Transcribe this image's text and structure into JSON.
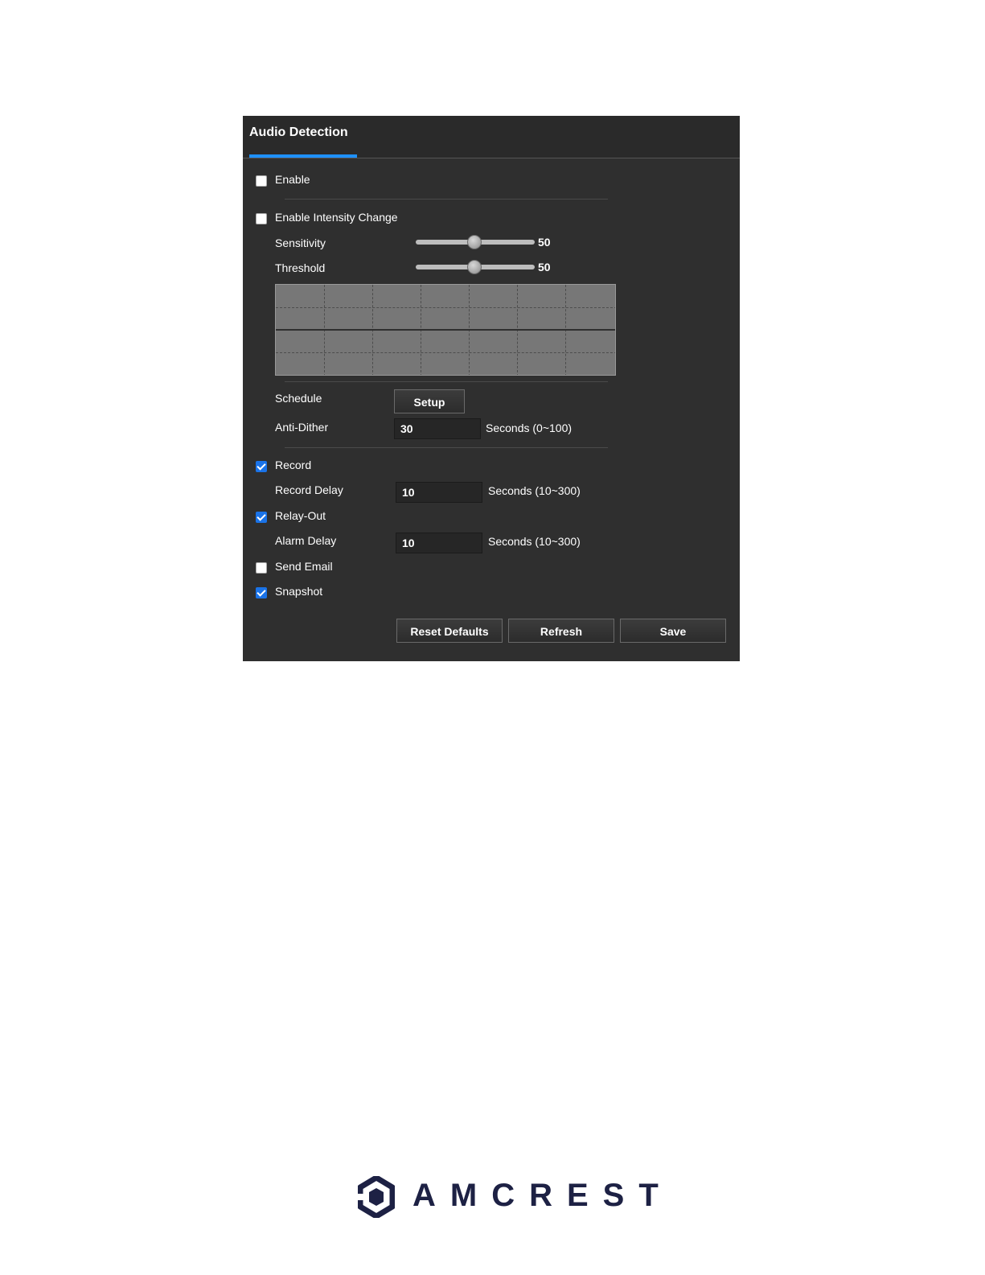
{
  "header": {
    "title": "Audio Detection"
  },
  "form": {
    "enable": {
      "label": "Enable",
      "checked": false
    },
    "intensity_change": {
      "label": "Enable Intensity Change",
      "checked": false
    },
    "sensitivity": {
      "label": "Sensitivity",
      "value": "50"
    },
    "threshold": {
      "label": "Threshold",
      "value": "50"
    },
    "schedule": {
      "label": "Schedule",
      "button": "Setup"
    },
    "anti_dither": {
      "label": "Anti-Dither",
      "value": "30",
      "unit": "Seconds (0~100)"
    },
    "record": {
      "label": "Record",
      "checked": true
    },
    "record_delay": {
      "label": "Record Delay",
      "value": "10",
      "unit": "Seconds (10~300)"
    },
    "relay_out": {
      "label": "Relay-Out",
      "checked": true
    },
    "alarm_delay": {
      "label": "Alarm Delay",
      "value": "10",
      "unit": "Seconds (10~300)"
    },
    "send_email": {
      "label": "Send Email",
      "checked": false
    },
    "snapshot": {
      "label": "Snapshot",
      "checked": true
    }
  },
  "buttons": {
    "reset": "Reset Defaults",
    "refresh": "Refresh",
    "save": "Save"
  },
  "brand": {
    "logo_text": "AMCREST",
    "accent_color": "#1e90ff",
    "logo_color": "#1d2144"
  }
}
